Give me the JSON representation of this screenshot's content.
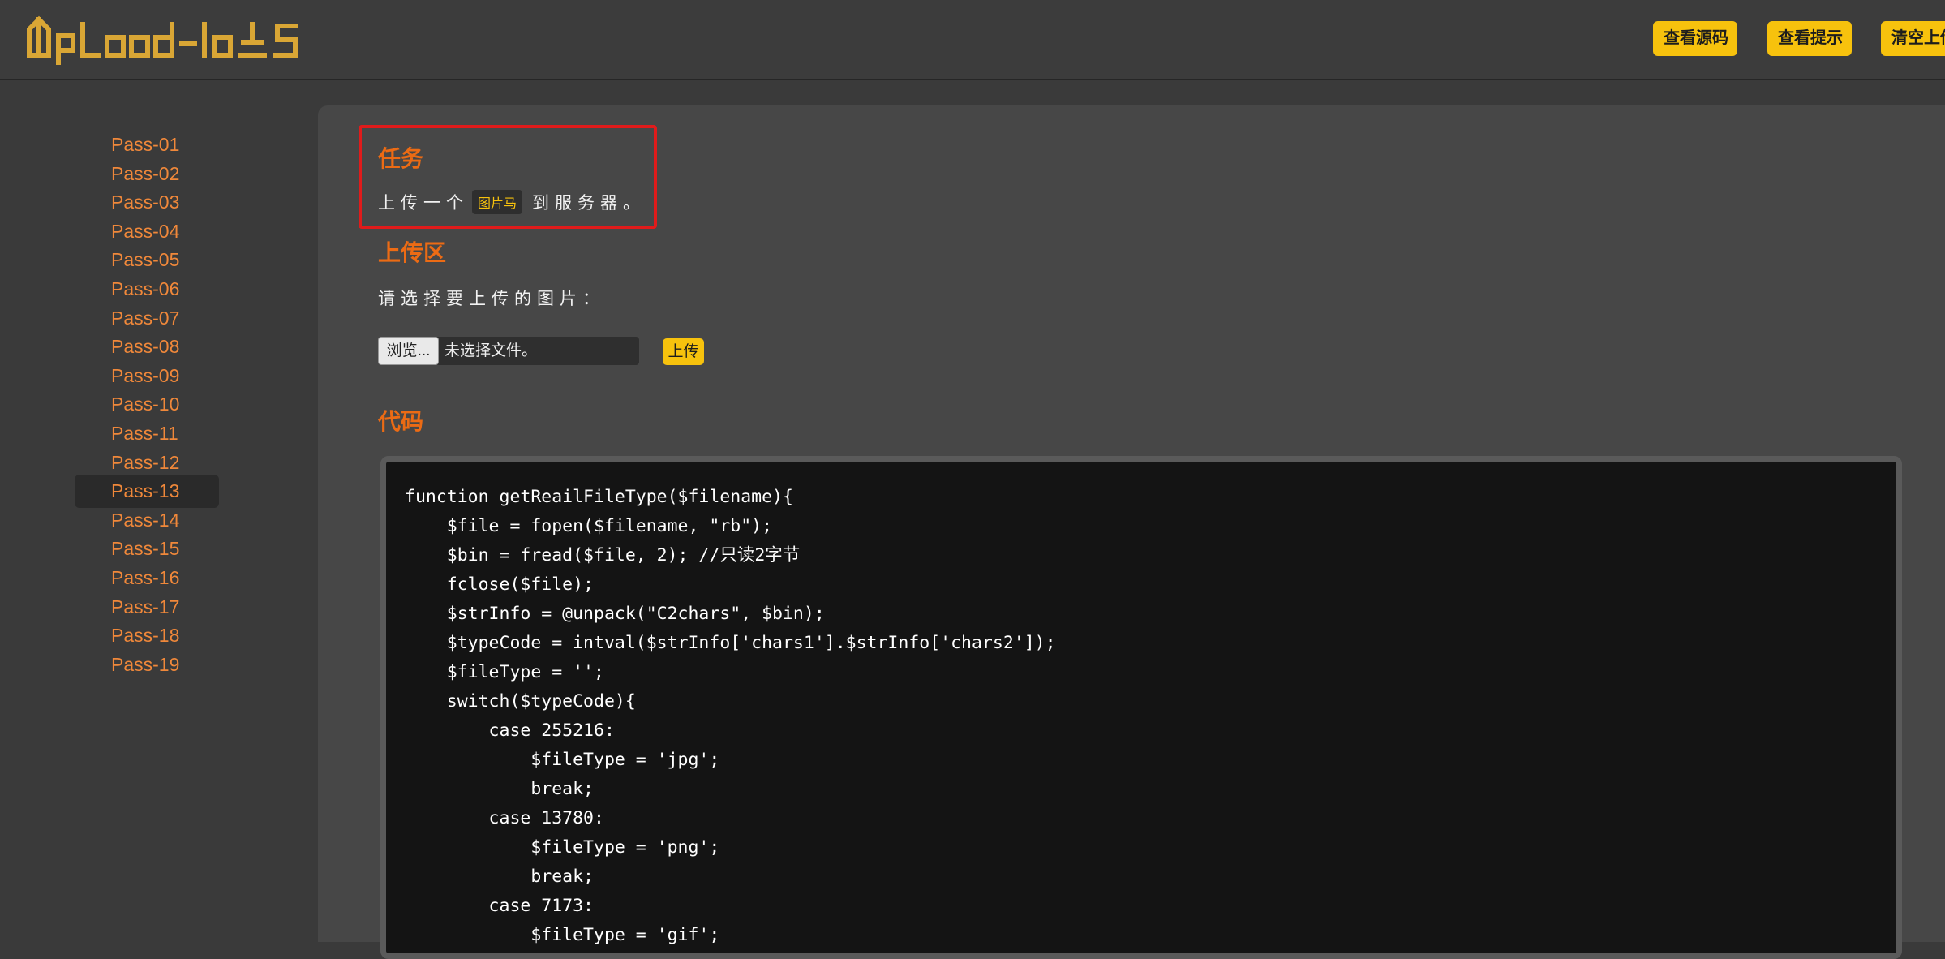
{
  "header": {
    "logo_text": "Upload-labs",
    "buttons": [
      {
        "label": "查看源码"
      },
      {
        "label": "查看提示"
      },
      {
        "label": "清空上传"
      }
    ]
  },
  "sidebar": {
    "items": [
      {
        "label": "Pass-01"
      },
      {
        "label": "Pass-02"
      },
      {
        "label": "Pass-03"
      },
      {
        "label": "Pass-04"
      },
      {
        "label": "Pass-05"
      },
      {
        "label": "Pass-06"
      },
      {
        "label": "Pass-07"
      },
      {
        "label": "Pass-08"
      },
      {
        "label": "Pass-09"
      },
      {
        "label": "Pass-10"
      },
      {
        "label": "Pass-11"
      },
      {
        "label": "Pass-12"
      },
      {
        "label": "Pass-13",
        "active": true
      },
      {
        "label": "Pass-14"
      },
      {
        "label": "Pass-15"
      },
      {
        "label": "Pass-16"
      },
      {
        "label": "Pass-17"
      },
      {
        "label": "Pass-18"
      },
      {
        "label": "Pass-19"
      }
    ]
  },
  "task": {
    "title": "任务",
    "text_before": "上传一个",
    "tag": "图片马",
    "text_after": "到服务器。"
  },
  "upload": {
    "title": "上传区",
    "label": "请选择要上传的图片：",
    "browse_label": "浏览...",
    "no_file_text": "未选择文件。",
    "submit_label": "上传"
  },
  "code": {
    "title": "代码",
    "lines": [
      "function getReailFileType($filename){",
      "    $file = fopen($filename, \"rb\");",
      "    $bin = fread($file, 2); //只读2字节",
      "    fclose($file);",
      "    $strInfo = @unpack(\"C2chars\", $bin);",
      "    $typeCode = intval($strInfo['chars1'].$strInfo['chars2']);",
      "    $fileType = '';",
      "    switch($typeCode){",
      "        case 255216:",
      "            $fileType = 'jpg';",
      "            break;",
      "        case 13780:",
      "            $fileType = 'png';",
      "            break;",
      "        case 7173:",
      "            $fileType = 'gif';"
    ]
  },
  "colors": {
    "accent_orange": "#ec6b14",
    "sidebar_link": "#f0883a",
    "button_yellow": "#f7c20d",
    "highlight_red": "#e01b1b"
  }
}
